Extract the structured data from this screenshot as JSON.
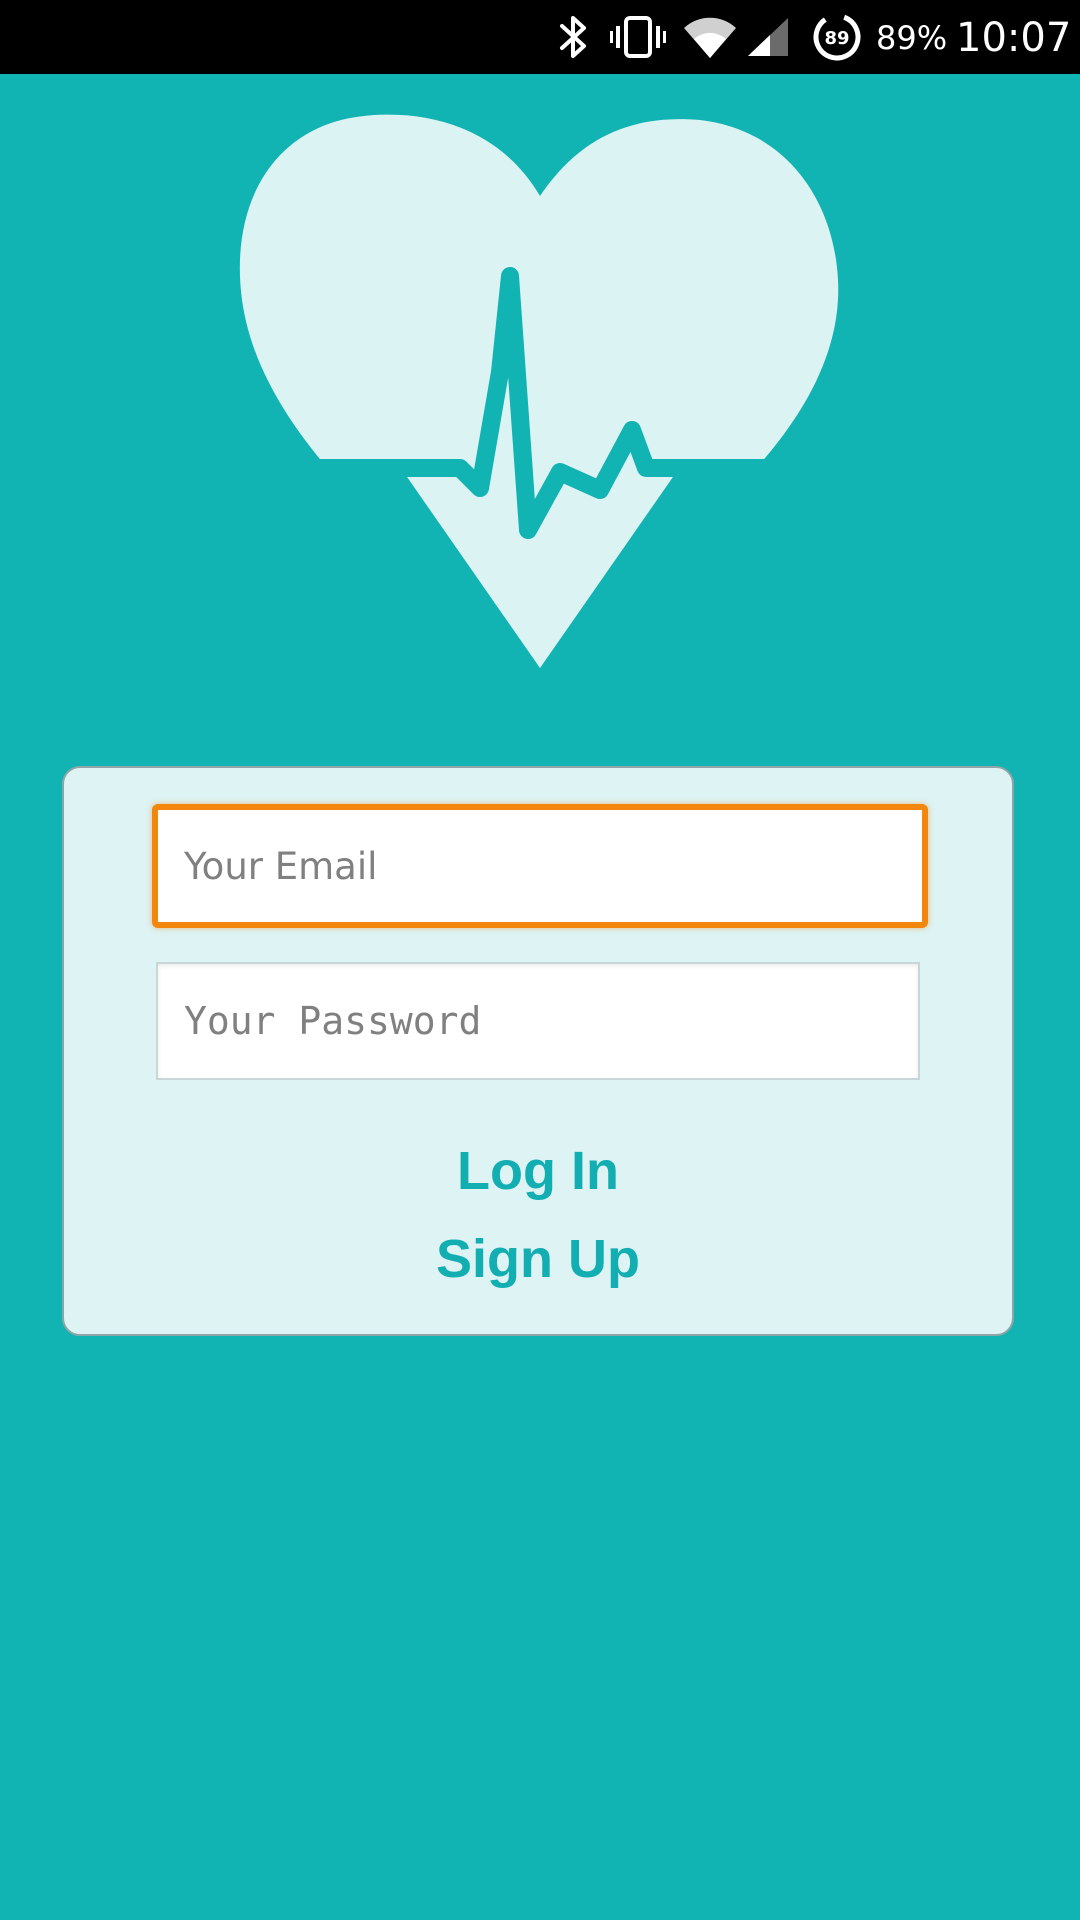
{
  "status_bar": {
    "battery_percent": "89%",
    "time": "10:07",
    "badge_count": "89",
    "icons": [
      "bluetooth-icon",
      "vibrate-icon",
      "wifi-icon",
      "cell-signal-icon",
      "data-saver-icon"
    ]
  },
  "logo": {
    "icon": "heart-pulse-icon",
    "colors": {
      "heart": "#dcf3f4",
      "pulse": "#12b3b3"
    }
  },
  "login_form": {
    "email_placeholder": "Your Email",
    "password_placeholder": "Your Password",
    "login_label": "Log In",
    "signup_label": "Sign Up"
  },
  "colors": {
    "background": "#12b3b3",
    "card": "#ddf3f4",
    "focus_border": "#f3860d",
    "link": "#12aeb1"
  }
}
